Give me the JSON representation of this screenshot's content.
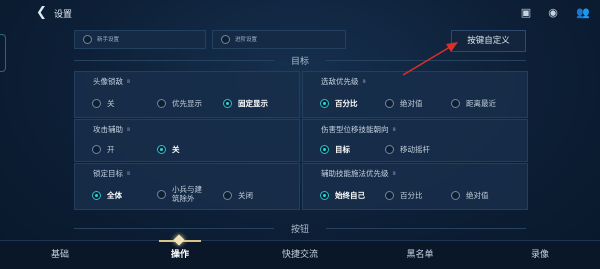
{
  "header": {
    "back_icon": "chevron-left-icon",
    "title": "设置",
    "icons": [
      "task-icon",
      "coin-icon",
      "friends-icon"
    ]
  },
  "top_options": [
    {
      "label": "新手设置"
    },
    {
      "label": "进阶设置"
    }
  ],
  "hotkey_button": "按键自定义",
  "sections": {
    "target": "目标",
    "buttons": "按钮"
  },
  "cards": [
    {
      "title": "头像锁敌",
      "options": [
        "关",
        "优先显示",
        "固定显示"
      ],
      "selected": 2
    },
    {
      "title": "选敌优先级",
      "options": [
        "百分比",
        "绝对值",
        "距离最近"
      ],
      "selected": 0
    },
    {
      "title": "攻击辅助",
      "options": [
        "开",
        "关"
      ],
      "selected": 1
    },
    {
      "title": "伤害型位移技能朝向",
      "options": [
        "目标",
        "移动摇杆"
      ],
      "selected": 0
    },
    {
      "title": "锁定目标",
      "options": [
        "全体",
        "小兵与建筑除外",
        "关闭"
      ],
      "selected": 0
    },
    {
      "title": "辅助技能施法优先级",
      "options": [
        "始终自己",
        "百分比",
        "绝对值"
      ],
      "selected": 0
    }
  ],
  "info_glyph": "ⅲ",
  "colors": {
    "accent": "#2fd3d6",
    "arrow": "#d9302a",
    "tab_indicator": "#d8c38a"
  },
  "bottom_tabs": [
    "基础",
    "操作",
    "快捷交流",
    "黑名单",
    "录像"
  ],
  "active_tab": 1
}
